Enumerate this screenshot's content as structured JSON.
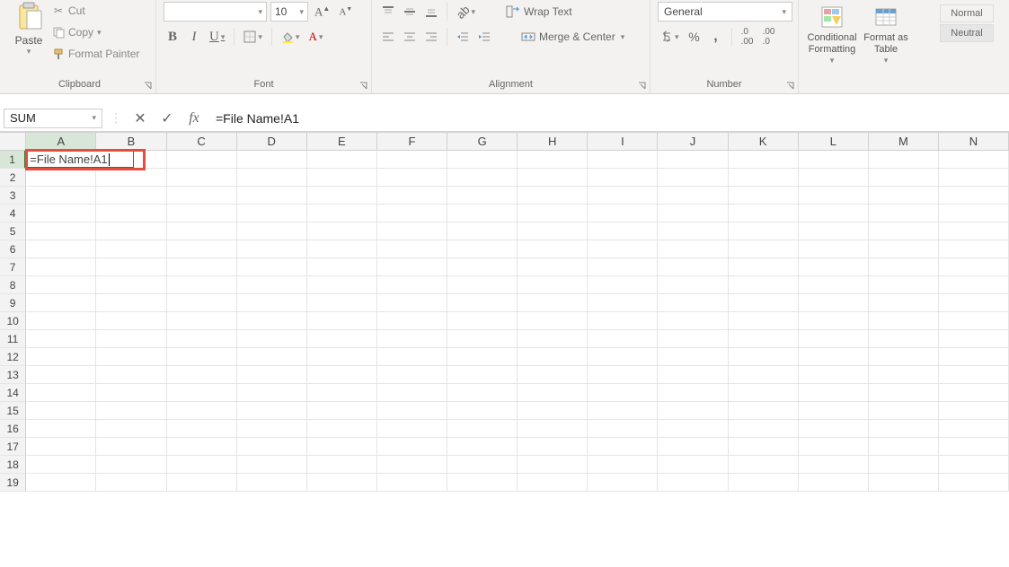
{
  "ribbon": {
    "clipboard": {
      "paste": "Paste",
      "cut": "Cut",
      "copy": "Copy",
      "format_painter": "Format Painter",
      "group_label": "Clipboard"
    },
    "font": {
      "size": "10",
      "bold": "B",
      "italic": "I",
      "underline": "U",
      "group_label": "Font"
    },
    "alignment": {
      "wrap_text": "Wrap Text",
      "merge_center": "Merge & Center",
      "group_label": "Alignment"
    },
    "number": {
      "format": "General",
      "group_label": "Number"
    },
    "styles": {
      "conditional": "Conditional Formatting",
      "format_table": "Format as Table",
      "normal": "Normal",
      "neutral": "Neutral"
    }
  },
  "formula_bar": {
    "name_box": "SUM",
    "fx": "fx",
    "formula": "=File Name!A1"
  },
  "grid": {
    "columns": [
      "A",
      "B",
      "C",
      "D",
      "E",
      "F",
      "G",
      "H",
      "I",
      "J",
      "K",
      "L",
      "M",
      "N"
    ],
    "rows": [
      1,
      2,
      3,
      4,
      5,
      6,
      7,
      8,
      9,
      10,
      11,
      12,
      13,
      14,
      15,
      16,
      17,
      18,
      19
    ],
    "active_cell_value": "=File Name!A1"
  }
}
